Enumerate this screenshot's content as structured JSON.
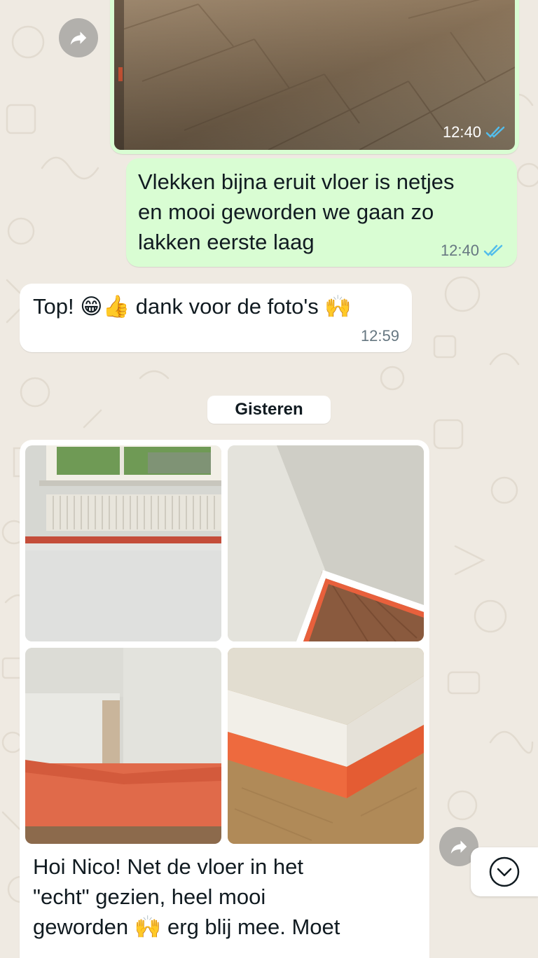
{
  "chat": {
    "sent_photo_time": "12:40",
    "sent_text": {
      "lines": [
        "Vlekken bijna eruit vloer is netjes",
        "en mooi geworden we gaan zo",
        "lakken eerste laag"
      ],
      "time": "12:40"
    },
    "received_reply": {
      "text_start": "Top!",
      "emoji1": "😁",
      "emoji2": "👍",
      "text_mid": "dank voor de foto's",
      "emoji3": "🙌",
      "time": "12:59"
    },
    "date_separator": "Gisteren",
    "received_album": {
      "caption_lines": [
        "Hoi Nico! Net de vloer in het",
        "\"echt\" gezien, heel mooi",
        "geworden"
      ],
      "caption_emoji": "🙌",
      "caption_tail": "erg blij mee. Moet"
    }
  },
  "icons": {
    "forward": "forward-arrow-icon",
    "read_receipt": "double-check-icon",
    "scroll_down": "chevron-down-icon"
  },
  "colors": {
    "background": "#efeae2",
    "outgoing_bubble": "#d9fdd3",
    "incoming_bubble": "#ffffff",
    "read_tick": "#53bdeb",
    "orange_tape": "#e8603c"
  }
}
